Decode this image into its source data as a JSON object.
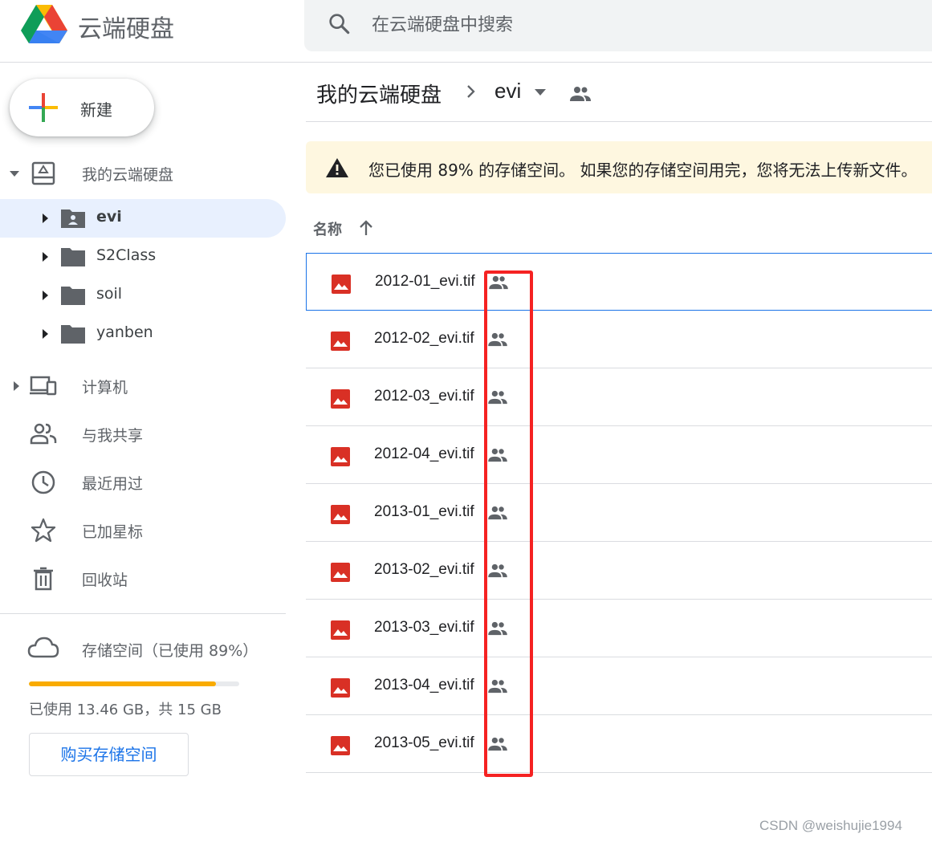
{
  "app": {
    "name": "云端硬盘"
  },
  "search": {
    "placeholder": "在云端硬盘中搜索"
  },
  "new_button": {
    "label": "新建"
  },
  "sidebar": {
    "my_drive": "我的云端硬盘",
    "folders": [
      {
        "label": "evi",
        "active": true
      },
      {
        "label": "S2Class"
      },
      {
        "label": "soil"
      },
      {
        "label": "yanben"
      }
    ],
    "computers": "计算机",
    "shared_with_me": "与我共享",
    "recent": "最近用过",
    "starred": "已加星标",
    "trash": "回收站",
    "storage": {
      "label": "存储空间（已使用 89%）",
      "used_fraction": 0.89,
      "usage_text": "已使用 13.46 GB，共 15 GB",
      "buy_label": "购买存储空间"
    }
  },
  "breadcrumb": {
    "root": "我的云端硬盘",
    "current": "evi"
  },
  "banner": {
    "message": "您已使用 89% 的存储空间。 如果您的存储空间用完，您将无法上传新文件。"
  },
  "list": {
    "column_name": "名称",
    "files": [
      {
        "name": "2012-01_evi.tif",
        "selected": true
      },
      {
        "name": "2012-02_evi.tif"
      },
      {
        "name": "2012-03_evi.tif"
      },
      {
        "name": "2012-04_evi.tif"
      },
      {
        "name": "2013-01_evi.tif"
      },
      {
        "name": "2013-02_evi.tif"
      },
      {
        "name": "2013-03_evi.tif"
      },
      {
        "name": "2013-04_evi.tif"
      },
      {
        "name": "2013-05_evi.tif"
      }
    ]
  },
  "watermark": "CSDN @weishujie1994",
  "colors": {
    "accent": "#1a73e8",
    "active_bg": "#e8f0fe",
    "warning_bg": "#fef7e0",
    "highlight": "#f52222",
    "image_icon": "#d93025",
    "storage_bar": "#f9ab00"
  },
  "icons": [
    "drive-logo",
    "search-icon",
    "plus-icon",
    "my-drive-icon",
    "folder-shared-icon",
    "folder-icon",
    "computer-icon",
    "people-icon",
    "clock-icon",
    "star-icon",
    "trash-icon",
    "cloud-icon",
    "warning-icon",
    "arrow-up-icon",
    "image-file-icon",
    "shared-icon"
  ]
}
